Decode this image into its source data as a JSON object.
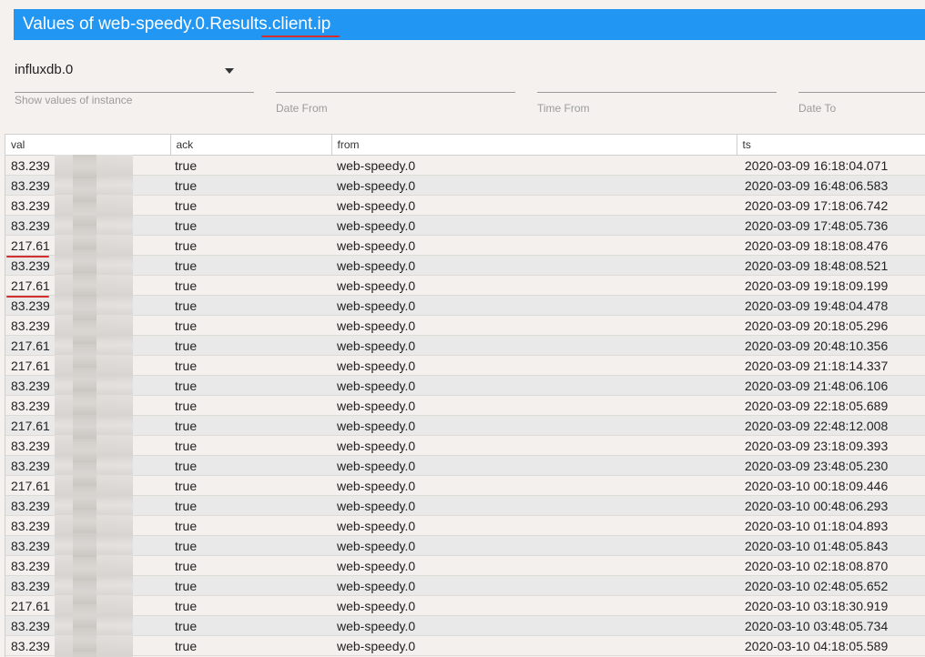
{
  "title": {
    "prefix": "Values of web-speedy.0.Results.",
    "highlight": "client.ip"
  },
  "filters": {
    "instance_value": "influxdb.0",
    "instance_hint": "Show values of instance",
    "date_from": "Date From",
    "time_from": "Time From",
    "date_to": "Date To"
  },
  "table": {
    "columns": [
      "val",
      "ack",
      "from",
      "ts"
    ],
    "rows": [
      {
        "val": "83.239",
        "ack": "true",
        "from": "web-speedy.0",
        "ts": "2020-03-09 16:18:04.071"
      },
      {
        "val": "83.239",
        "ack": "true",
        "from": "web-speedy.0",
        "ts": "2020-03-09 16:48:06.583"
      },
      {
        "val": "83.239",
        "ack": "true",
        "from": "web-speedy.0",
        "ts": "2020-03-09 17:18:06.742"
      },
      {
        "val": "83.239",
        "ack": "true",
        "from": "web-speedy.0",
        "ts": "2020-03-09 17:48:05.736"
      },
      {
        "val": "217.61",
        "ack": "true",
        "from": "web-speedy.0",
        "ts": "2020-03-09 18:18:08.476"
      },
      {
        "val": "83.239",
        "ack": "true",
        "from": "web-speedy.0",
        "ts": "2020-03-09 18:48:08.521"
      },
      {
        "val": "217.61",
        "ack": "true",
        "from": "web-speedy.0",
        "ts": "2020-03-09 19:18:09.199"
      },
      {
        "val": "83.239",
        "ack": "true",
        "from": "web-speedy.0",
        "ts": "2020-03-09 19:48:04.478"
      },
      {
        "val": "83.239",
        "ack": "true",
        "from": "web-speedy.0",
        "ts": "2020-03-09 20:18:05.296"
      },
      {
        "val": "217.61",
        "ack": "true",
        "from": "web-speedy.0",
        "ts": "2020-03-09 20:48:10.356"
      },
      {
        "val": "217.61",
        "ack": "true",
        "from": "web-speedy.0",
        "ts": "2020-03-09 21:18:14.337"
      },
      {
        "val": "83.239",
        "ack": "true",
        "from": "web-speedy.0",
        "ts": "2020-03-09 21:48:06.106"
      },
      {
        "val": "83.239",
        "ack": "true",
        "from": "web-speedy.0",
        "ts": "2020-03-09 22:18:05.689"
      },
      {
        "val": "217.61",
        "ack": "true",
        "from": "web-speedy.0",
        "ts": "2020-03-09 22:48:12.008"
      },
      {
        "val": "83.239",
        "ack": "true",
        "from": "web-speedy.0",
        "ts": "2020-03-09 23:18:09.393"
      },
      {
        "val": "83.239",
        "ack": "true",
        "from": "web-speedy.0",
        "ts": "2020-03-09 23:48:05.230"
      },
      {
        "val": "217.61",
        "ack": "true",
        "from": "web-speedy.0",
        "ts": "2020-03-10 00:18:09.446"
      },
      {
        "val": "83.239",
        "ack": "true",
        "from": "web-speedy.0",
        "ts": "2020-03-10 00:48:06.293"
      },
      {
        "val": "83.239",
        "ack": "true",
        "from": "web-speedy.0",
        "ts": "2020-03-10 01:18:04.893"
      },
      {
        "val": "83.239",
        "ack": "true",
        "from": "web-speedy.0",
        "ts": "2020-03-10 01:48:05.843"
      },
      {
        "val": "83.239",
        "ack": "true",
        "from": "web-speedy.0",
        "ts": "2020-03-10 02:18:08.870"
      },
      {
        "val": "83.239",
        "ack": "true",
        "from": "web-speedy.0",
        "ts": "2020-03-10 02:48:05.652"
      },
      {
        "val": "217.61",
        "ack": "true",
        "from": "web-speedy.0",
        "ts": "2020-03-10 03:18:30.919"
      },
      {
        "val": "83.239",
        "ack": "true",
        "from": "web-speedy.0",
        "ts": "2020-03-10 03:48:05.734"
      },
      {
        "val": "83.239",
        "ack": "true",
        "from": "web-speedy.0",
        "ts": "2020-03-10 04:18:05.589"
      }
    ]
  },
  "colors": {
    "title_bg": "#2196f3",
    "annotation_red": "#d32f2f"
  }
}
